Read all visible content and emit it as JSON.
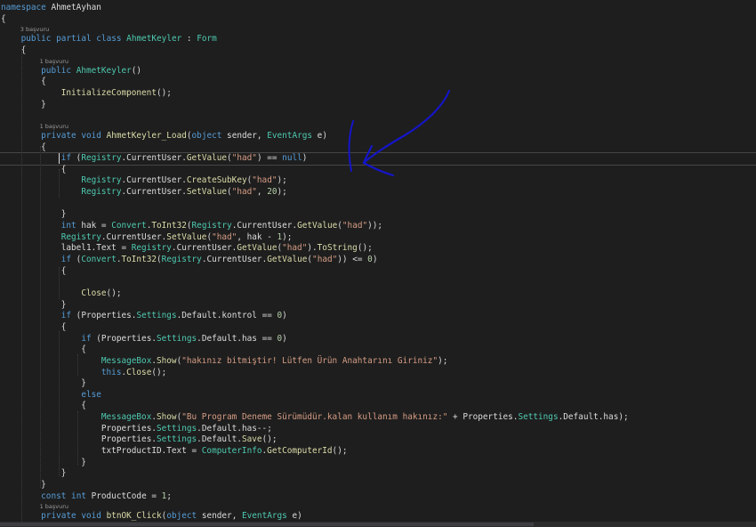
{
  "editor": {
    "lines": [
      {
        "tokens": [
          {
            "t": "namespace",
            "c": "kw"
          },
          {
            "t": " AhmetAyhan",
            "c": "id"
          }
        ]
      },
      {
        "tokens": [
          {
            "t": "{",
            "c": "id"
          }
        ]
      },
      {
        "ref": "3 başvuru"
      },
      {
        "tokens": [
          {
            "t": "    "
          },
          {
            "t": "public",
            "c": "kw"
          },
          {
            "t": " "
          },
          {
            "t": "partial",
            "c": "kw"
          },
          {
            "t": " "
          },
          {
            "t": "class",
            "c": "kw"
          },
          {
            "t": " "
          },
          {
            "t": "AhmetKeyler",
            "c": "type"
          },
          {
            "t": " : "
          },
          {
            "t": "Form",
            "c": "type"
          }
        ]
      },
      {
        "tokens": [
          {
            "t": "    {"
          }
        ]
      },
      {
        "ref": "1 başvuru"
      },
      {
        "tokens": [
          {
            "t": "        "
          },
          {
            "t": "public",
            "c": "kw"
          },
          {
            "t": " "
          },
          {
            "t": "AhmetKeyler",
            "c": "type"
          },
          {
            "t": "()"
          }
        ]
      },
      {
        "tokens": [
          {
            "t": "        {"
          }
        ]
      },
      {
        "tokens": [
          {
            "t": "            "
          },
          {
            "t": "InitializeComponent",
            "c": "fn"
          },
          {
            "t": "();"
          }
        ]
      },
      {
        "tokens": [
          {
            "t": "        }"
          }
        ]
      },
      {
        "tokens": []
      },
      {
        "ref": "1 başvuru"
      },
      {
        "tokens": [
          {
            "t": "        "
          },
          {
            "t": "private",
            "c": "kw"
          },
          {
            "t": " "
          },
          {
            "t": "void",
            "c": "kw"
          },
          {
            "t": " "
          },
          {
            "t": "AhmetKeyler_Load",
            "c": "fn"
          },
          {
            "t": "("
          },
          {
            "t": "object",
            "c": "kw"
          },
          {
            "t": " sender, "
          },
          {
            "t": "EventArgs",
            "c": "type"
          },
          {
            "t": " e)"
          }
        ]
      },
      {
        "tokens": [
          {
            "t": "        {"
          }
        ]
      },
      {
        "tokens": [
          {
            "t": "            "
          },
          {
            "t": "if",
            "c": "kw"
          },
          {
            "t": " ("
          },
          {
            "t": "Registry",
            "c": "type"
          },
          {
            "t": "."
          },
          {
            "t": "CurrentUser",
            "c": "prop"
          },
          {
            "t": "."
          },
          {
            "t": "GetValue",
            "c": "fn"
          },
          {
            "t": "("
          },
          {
            "t": "\"had\"",
            "c": "str"
          },
          {
            "t": ") == "
          },
          {
            "t": "null",
            "c": "kw"
          },
          {
            "t": ")"
          }
        ],
        "current": true
      },
      {
        "tokens": [
          {
            "t": "            {"
          }
        ]
      },
      {
        "tokens": [
          {
            "t": "                "
          },
          {
            "t": "Registry",
            "c": "type"
          },
          {
            "t": "."
          },
          {
            "t": "CurrentUser",
            "c": "prop"
          },
          {
            "t": "."
          },
          {
            "t": "CreateSubKey",
            "c": "fn"
          },
          {
            "t": "("
          },
          {
            "t": "\"had\"",
            "c": "str"
          },
          {
            "t": ");"
          }
        ]
      },
      {
        "tokens": [
          {
            "t": "                "
          },
          {
            "t": "Registry",
            "c": "type"
          },
          {
            "t": "."
          },
          {
            "t": "CurrentUser",
            "c": "prop"
          },
          {
            "t": "."
          },
          {
            "t": "SetValue",
            "c": "fn"
          },
          {
            "t": "("
          },
          {
            "t": "\"had\"",
            "c": "str"
          },
          {
            "t": ", "
          },
          {
            "t": "20",
            "c": "num"
          },
          {
            "t": ");"
          }
        ]
      },
      {
        "tokens": []
      },
      {
        "tokens": [
          {
            "t": "            }"
          }
        ]
      },
      {
        "tokens": [
          {
            "t": "            "
          },
          {
            "t": "int",
            "c": "kw"
          },
          {
            "t": " hak = "
          },
          {
            "t": "Convert",
            "c": "type"
          },
          {
            "t": "."
          },
          {
            "t": "ToInt32",
            "c": "fn"
          },
          {
            "t": "("
          },
          {
            "t": "Registry",
            "c": "type"
          },
          {
            "t": "."
          },
          {
            "t": "CurrentUser",
            "c": "prop"
          },
          {
            "t": "."
          },
          {
            "t": "GetValue",
            "c": "fn"
          },
          {
            "t": "("
          },
          {
            "t": "\"had\"",
            "c": "str"
          },
          {
            "t": "));"
          }
        ]
      },
      {
        "tokens": [
          {
            "t": "            "
          },
          {
            "t": "Registry",
            "c": "type"
          },
          {
            "t": "."
          },
          {
            "t": "CurrentUser",
            "c": "prop"
          },
          {
            "t": "."
          },
          {
            "t": "SetValue",
            "c": "fn"
          },
          {
            "t": "("
          },
          {
            "t": "\"had\"",
            "c": "str"
          },
          {
            "t": ", hak - "
          },
          {
            "t": "1",
            "c": "num"
          },
          {
            "t": ");"
          }
        ]
      },
      {
        "tokens": [
          {
            "t": "            label1.Text = "
          },
          {
            "t": "Registry",
            "c": "type"
          },
          {
            "t": "."
          },
          {
            "t": "CurrentUser",
            "c": "prop"
          },
          {
            "t": "."
          },
          {
            "t": "GetValue",
            "c": "fn"
          },
          {
            "t": "("
          },
          {
            "t": "\"had\"",
            "c": "str"
          },
          {
            "t": ")."
          },
          {
            "t": "ToString",
            "c": "fn"
          },
          {
            "t": "();"
          }
        ]
      },
      {
        "tokens": [
          {
            "t": "            "
          },
          {
            "t": "if",
            "c": "kw"
          },
          {
            "t": " ("
          },
          {
            "t": "Convert",
            "c": "type"
          },
          {
            "t": "."
          },
          {
            "t": "ToInt32",
            "c": "fn"
          },
          {
            "t": "("
          },
          {
            "t": "Registry",
            "c": "type"
          },
          {
            "t": "."
          },
          {
            "t": "CurrentUser",
            "c": "prop"
          },
          {
            "t": "."
          },
          {
            "t": "GetValue",
            "c": "fn"
          },
          {
            "t": "("
          },
          {
            "t": "\"had\"",
            "c": "str"
          },
          {
            "t": ")) <= "
          },
          {
            "t": "0",
            "c": "num"
          },
          {
            "t": ")"
          }
        ]
      },
      {
        "tokens": [
          {
            "t": "            {"
          }
        ]
      },
      {
        "tokens": []
      },
      {
        "tokens": [
          {
            "t": "                "
          },
          {
            "t": "Close",
            "c": "fn"
          },
          {
            "t": "();"
          }
        ]
      },
      {
        "tokens": [
          {
            "t": "            }"
          }
        ]
      },
      {
        "tokens": [
          {
            "t": "            "
          },
          {
            "t": "if",
            "c": "kw"
          },
          {
            "t": " ("
          },
          {
            "t": "Properties",
            "c": "id"
          },
          {
            "t": "."
          },
          {
            "t": "Settings",
            "c": "type"
          },
          {
            "t": "."
          },
          {
            "t": "Default",
            "c": "prop"
          },
          {
            "t": ".kontrol == "
          },
          {
            "t": "0",
            "c": "num"
          },
          {
            "t": ")"
          }
        ]
      },
      {
        "tokens": [
          {
            "t": "            {"
          }
        ]
      },
      {
        "tokens": [
          {
            "t": "                "
          },
          {
            "t": "if",
            "c": "kw"
          },
          {
            "t": " ("
          },
          {
            "t": "Properties",
            "c": "id"
          },
          {
            "t": "."
          },
          {
            "t": "Settings",
            "c": "type"
          },
          {
            "t": "."
          },
          {
            "t": "Default",
            "c": "prop"
          },
          {
            "t": ".has == "
          },
          {
            "t": "0",
            "c": "num"
          },
          {
            "t": ")"
          }
        ]
      },
      {
        "tokens": [
          {
            "t": "                {"
          }
        ]
      },
      {
        "tokens": [
          {
            "t": "                    "
          },
          {
            "t": "MessageBox",
            "c": "type"
          },
          {
            "t": "."
          },
          {
            "t": "Show",
            "c": "fn"
          },
          {
            "t": "("
          },
          {
            "t": "\"hakınız bitmiştir! Lütfen Ürün Anahtarını Giriniz\"",
            "c": "str"
          },
          {
            "t": ");"
          }
        ]
      },
      {
        "tokens": [
          {
            "t": "                    "
          },
          {
            "t": "this",
            "c": "kw"
          },
          {
            "t": "."
          },
          {
            "t": "Close",
            "c": "fn"
          },
          {
            "t": "();"
          }
        ]
      },
      {
        "tokens": [
          {
            "t": "                }"
          }
        ]
      },
      {
        "tokens": [
          {
            "t": "                "
          },
          {
            "t": "else",
            "c": "kw"
          }
        ]
      },
      {
        "tokens": [
          {
            "t": "                {"
          }
        ]
      },
      {
        "tokens": [
          {
            "t": "                    "
          },
          {
            "t": "MessageBox",
            "c": "type"
          },
          {
            "t": "."
          },
          {
            "t": "Show",
            "c": "fn"
          },
          {
            "t": "("
          },
          {
            "t": "\"Bu Program Deneme Sürümüdür.kalan kullanım hakınız:\"",
            "c": "str"
          },
          {
            "t": " + "
          },
          {
            "t": "Properties",
            "c": "id"
          },
          {
            "t": "."
          },
          {
            "t": "Settings",
            "c": "type"
          },
          {
            "t": "."
          },
          {
            "t": "Default",
            "c": "prop"
          },
          {
            "t": ".has);"
          }
        ]
      },
      {
        "tokens": [
          {
            "t": "                    "
          },
          {
            "t": "Properties",
            "c": "id"
          },
          {
            "t": "."
          },
          {
            "t": "Settings",
            "c": "type"
          },
          {
            "t": "."
          },
          {
            "t": "Default",
            "c": "prop"
          },
          {
            "t": ".has--;"
          }
        ]
      },
      {
        "tokens": [
          {
            "t": "                    "
          },
          {
            "t": "Properties",
            "c": "id"
          },
          {
            "t": "."
          },
          {
            "t": "Settings",
            "c": "type"
          },
          {
            "t": "."
          },
          {
            "t": "Default",
            "c": "prop"
          },
          {
            "t": "."
          },
          {
            "t": "Save",
            "c": "fn"
          },
          {
            "t": "();"
          }
        ]
      },
      {
        "tokens": [
          {
            "t": "                    txtProductID.Text = "
          },
          {
            "t": "ComputerInfo",
            "c": "type"
          },
          {
            "t": "."
          },
          {
            "t": "GetComputerId",
            "c": "fn"
          },
          {
            "t": "();"
          }
        ]
      },
      {
        "tokens": [
          {
            "t": "                }"
          }
        ]
      },
      {
        "tokens": [
          {
            "t": "            }"
          }
        ]
      },
      {
        "tokens": [
          {
            "t": "        }"
          }
        ]
      },
      {
        "tokens": [
          {
            "t": "        "
          },
          {
            "t": "const",
            "c": "kw"
          },
          {
            "t": " "
          },
          {
            "t": "int",
            "c": "kw"
          },
          {
            "t": " ProductCode = "
          },
          {
            "t": "1",
            "c": "num"
          },
          {
            "t": ";"
          }
        ]
      },
      {
        "ref": "1 başvuru"
      },
      {
        "tokens": [
          {
            "t": "        "
          },
          {
            "t": "private",
            "c": "kw"
          },
          {
            "t": " "
          },
          {
            "t": "void",
            "c": "kw"
          },
          {
            "t": " "
          },
          {
            "t": "btnOK_Click",
            "c": "fn"
          },
          {
            "t": "("
          },
          {
            "t": "object",
            "c": "kw"
          },
          {
            "t": " sender, "
          },
          {
            "t": "EventArgs",
            "c": "type"
          },
          {
            "t": " e)"
          }
        ]
      }
    ]
  },
  "annotation": {
    "color": "#1515c8",
    "shape": "hand-drawn-arrow-and-bracket"
  },
  "colors": {
    "background": "#1e1e1e",
    "keyword": "#569cd6",
    "type": "#4ec9b0",
    "string": "#d69d85",
    "number": "#b5cea8",
    "method": "#dcdcaa",
    "plain": "#dcdcdc",
    "reference_lens": "#999999"
  }
}
